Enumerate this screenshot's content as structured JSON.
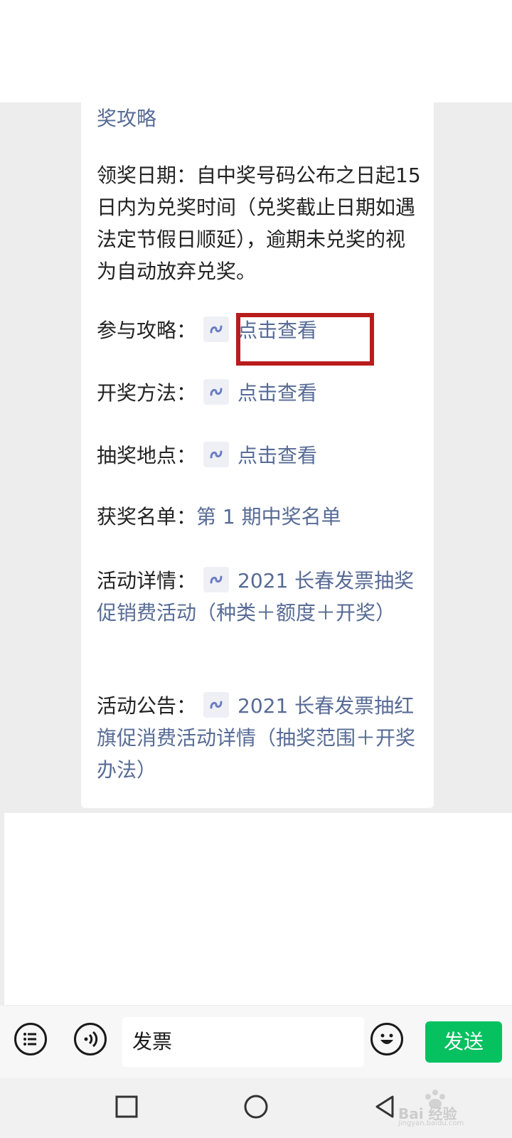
{
  "article": {
    "fragment_top": "奖攻略",
    "claim_paragraph": "领奖日期：自中奖号码公布之日起15 日内为兑奖时间（兑奖截止日期如遇法定节假日顺延），逾期未兑奖的视为自动放弃兑奖。",
    "rows": [
      {
        "label": "参与攻略：",
        "link": "点击查看"
      },
      {
        "label": "开奖方法：",
        "link": "点击查看"
      },
      {
        "label": "抽奖地点：",
        "link": "点击查看"
      },
      {
        "label": "获奖名单：",
        "link": "第 1 期中奖名单"
      }
    ],
    "detail_label": "活动详情：",
    "detail_link": "2021 长春发票抽奖促销费活动（种类＋额度＋开奖）",
    "notice_label": "活动公告：",
    "notice_link": "2021 长春发票抽红旗促消费活动详情（抽奖范围＋开奖办法）"
  },
  "input_bar": {
    "input_value": "发票",
    "send_label": "发送"
  },
  "watermark": {
    "text": "Bai 经验",
    "subtext": "jingyan.baidu.com"
  },
  "colors": {
    "link": "#576b95",
    "send": "#07c160",
    "highlight": "#b91c1c"
  }
}
